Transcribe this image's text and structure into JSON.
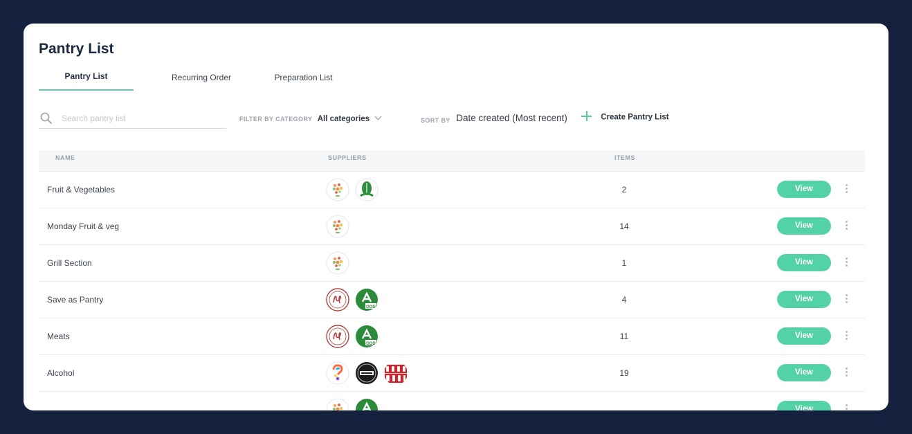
{
  "page": {
    "title": "Pantry List"
  },
  "tabs": [
    {
      "label": "Pantry List",
      "active": true
    },
    {
      "label": "Recurring Order",
      "active": false
    },
    {
      "label": "Preparation List",
      "active": false
    }
  ],
  "toolbar": {
    "search_placeholder": "Search pantry list",
    "filter_label": "FILTER BY CATEGORY",
    "filter_value": "All categories",
    "sort_label": "SORT BY",
    "sort_value": "Date created (Most recent)",
    "create_label": "Create Pantry List"
  },
  "table": {
    "columns": {
      "name": "NAME",
      "suppliers": "SUPPLIERS",
      "items": "ITEMS"
    },
    "view_label": "View",
    "rows": [
      {
        "name": "Fruit & Vegetables",
        "items": "2",
        "suppliers": [
          "fruit-supplier-logo",
          "green-leaf-supplier-logo"
        ]
      },
      {
        "name": "Monday Fruit & veg",
        "items": "14",
        "suppliers": [
          "fruit-supplier-logo"
        ]
      },
      {
        "name": "Grill Section",
        "items": "1",
        "suppliers": [
          "fruit-supplier-logo"
        ]
      },
      {
        "name": "Save as Pantry",
        "items": "4",
        "suppliers": [
          "lps-supplier-logo",
          "a-foods-supplier-logo"
        ]
      },
      {
        "name": "Meats",
        "items": "11",
        "suppliers": [
          "lps-supplier-logo",
          "a-foods-supplier-logo"
        ]
      },
      {
        "name": "Alcohol",
        "items": "19",
        "suppliers": [
          "colorful-question-supplier-logo",
          "beer-cartel-supplier-logo",
          "red-text-supplier-logo"
        ]
      },
      {
        "name": "",
        "items": "",
        "suppliers": [
          "fruit-supplier-logo",
          "a-foods-supplier-logo"
        ]
      }
    ]
  },
  "colors": {
    "background": "#15203f",
    "accent": "#53d3a5",
    "title": "#1c2740"
  }
}
